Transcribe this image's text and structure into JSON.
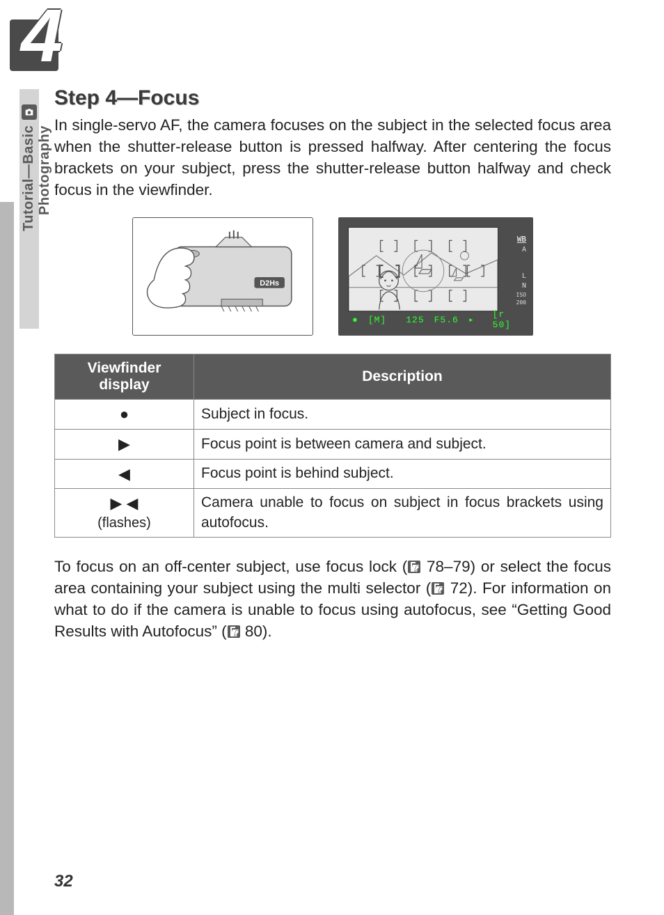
{
  "chapter": {
    "number": "4"
  },
  "sidebar": {
    "label": "Tutorial—Basic Photography",
    "icon": "camera-icon"
  },
  "heading": "Step 4—Focus",
  "intro": "In single-servo AF, the camera focuses on the subject in the selected focus area when the shutter-release button is pressed halfway.  After centering the focus brackets on your subject, press the shutter-release button halfway and check focus in the viewfinder.",
  "viewfinder_overlay": {
    "right": {
      "wb": "WB",
      "mode": "A",
      "quality": "L",
      "size": "N",
      "iso": "ISO\n200"
    },
    "bottom": {
      "dot": "●",
      "af": "[M]",
      "shutter": "125",
      "aperture": "F5.6",
      "meter": "▸",
      "count": "[r 50]"
    }
  },
  "table": {
    "headers": {
      "col1": "Viewfinder display",
      "col2": "Description"
    },
    "rows": [
      {
        "symbol": "●",
        "flashes": "",
        "desc": "Subject in focus."
      },
      {
        "symbol": "▶",
        "flashes": "",
        "desc": "Focus point is between camera and subject."
      },
      {
        "symbol": "◀",
        "flashes": "",
        "desc": "Focus point is behind subject."
      },
      {
        "symbol": "▶  ◀",
        "flashes": "(flashes)",
        "desc": "Camera unable to focus on subject in focus brackets using autofocus."
      }
    ]
  },
  "para2": {
    "seg1": "To focus on an off-center subject, use focus lock (",
    "ref1": " 78–79) or select the focus area containing your subject using the multi selector (",
    "ref2": " 72).  For information on what to do if the camera is unable to focus using autofocus, see “Getting Good Results with Autofocus” (",
    "ref3": " 80)."
  },
  "page_number": "32",
  "chart_data": null
}
